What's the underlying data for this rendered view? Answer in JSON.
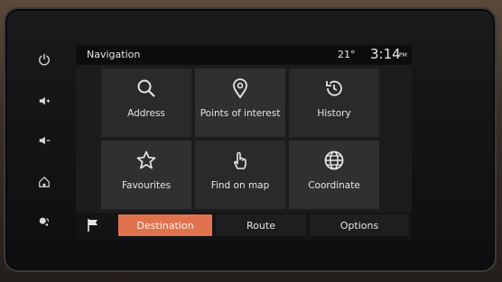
{
  "status": {
    "title": "Navigation",
    "temperature": "21°",
    "time": "3:14",
    "ampm": "PM"
  },
  "side_buttons": [
    {
      "name": "power-icon"
    },
    {
      "name": "volume-up-icon"
    },
    {
      "name": "volume-down-icon"
    },
    {
      "name": "home-icon"
    },
    {
      "name": "voice-icon"
    }
  ],
  "menu": {
    "items": [
      {
        "label": "Address",
        "icon": "search-icon"
      },
      {
        "label": "Points of interest",
        "icon": "location-pin-icon"
      },
      {
        "label": "History",
        "icon": "history-icon"
      },
      {
        "label": "Favourites",
        "icon": "star-icon"
      },
      {
        "label": "Find on map",
        "icon": "hand-pointer-icon"
      },
      {
        "label": "Coordinate",
        "icon": "globe-icon"
      }
    ]
  },
  "bottom": {
    "flag_icon": "flag-icon",
    "destination": "Destination",
    "route": "Route",
    "options": "Options"
  },
  "colors": {
    "accent": "#e0734e",
    "screen_bg": "#1c1c1e",
    "text": "#e6e6e6"
  }
}
